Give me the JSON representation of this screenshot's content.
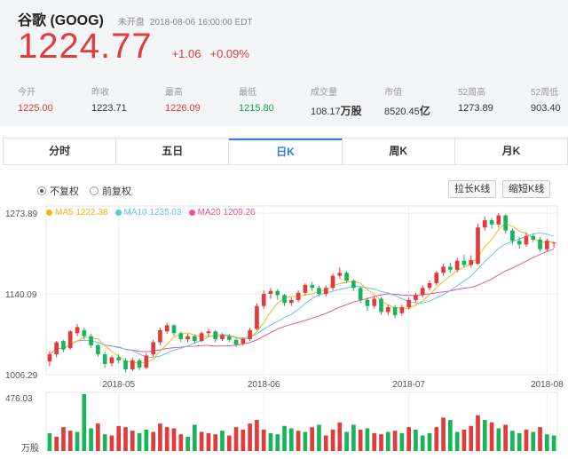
{
  "stock": {
    "name": "谷歌 (GOOG)",
    "status": "未开盘",
    "time": "2018-08-06  16:00:00  EDT",
    "price": "1224.77",
    "change": "+1.06",
    "change_pct": "+0.09%"
  },
  "stats": [
    {
      "label": "今开",
      "value": "1225.00",
      "color": "red"
    },
    {
      "label": "昨收",
      "value": "1223.71",
      "color": "normal"
    },
    {
      "label": "最高",
      "value": "1226.09",
      "color": "red"
    },
    {
      "label": "最低",
      "value": "1215.80",
      "color": "green"
    },
    {
      "label": "成交量",
      "value": "108.17",
      "unit": "万股",
      "color": "normal"
    },
    {
      "label": "市值",
      "value": "8520.45",
      "unit": "亿",
      "color": "normal"
    },
    {
      "label": "52周高",
      "value": "1273.89",
      "color": "normal"
    },
    {
      "label": "52周低",
      "value": "903.40",
      "color": "normal"
    }
  ],
  "tabs": [
    "分时",
    "五日",
    "日K",
    "周K",
    "月K"
  ],
  "active_tab": "日K",
  "radio": {
    "option1": "不复权",
    "option2": "前复权"
  },
  "buttons": {
    "stretch": "拉长K线",
    "shorten": "缩短K线"
  },
  "legend": {
    "ma5": "MA5 1222.38",
    "ma10": "MA10 1235.03",
    "ma20": "MA20 1209.26"
  },
  "colors": {
    "up": "#e23b3b",
    "down": "#19b35a",
    "ma5": "#f2b71b",
    "ma10": "#5ec9e8",
    "ma20": "#e9559a",
    "accent": "#2d7be5"
  },
  "chart_data": {
    "type": "candlestick",
    "price_axis_labels": [
      "1273.89",
      "1140.09",
      "1006.29"
    ],
    "ylim": [
      1006.29,
      1273.89
    ],
    "volume_axis_labels": [
      "476.03",
      "万股"
    ],
    "volume_max": 476.03,
    "x_labels": [
      "2018-05",
      "2018-06",
      "2018-07",
      "2018-08"
    ],
    "x_label_index": [
      10,
      31,
      52,
      72
    ],
    "candles": [
      [
        1028,
        1040,
        1020,
        1045
      ],
      [
        1040,
        1060,
        1035,
        1062
      ],
      [
        1062,
        1048,
        1044,
        1064
      ],
      [
        1050,
        1078,
        1048,
        1080
      ],
      [
        1075,
        1085,
        1070,
        1090
      ],
      [
        1080,
        1070,
        1065,
        1084
      ],
      [
        1070,
        1055,
        1050,
        1074
      ],
      [
        1055,
        1040,
        1036,
        1058
      ],
      [
        1040,
        1024,
        1018,
        1044
      ],
      [
        1025,
        1035,
        1020,
        1038
      ],
      [
        1035,
        1030,
        1025,
        1040
      ],
      [
        1030,
        1015,
        1010,
        1034
      ],
      [
        1015,
        1030,
        1012,
        1034
      ],
      [
        1030,
        1018,
        1014,
        1033
      ],
      [
        1018,
        1038,
        1015,
        1042
      ],
      [
        1040,
        1060,
        1036,
        1064
      ],
      [
        1060,
        1080,
        1055,
        1084
      ],
      [
        1078,
        1088,
        1074,
        1092
      ],
      [
        1088,
        1075,
        1070,
        1090
      ],
      [
        1075,
        1065,
        1060,
        1078
      ],
      [
        1065,
        1070,
        1060,
        1074
      ],
      [
        1070,
        1062,
        1058,
        1073
      ],
      [
        1062,
        1075,
        1060,
        1078
      ],
      [
        1075,
        1078,
        1070,
        1082
      ],
      [
        1078,
        1065,
        1060,
        1080
      ],
      [
        1065,
        1072,
        1062,
        1075
      ],
      [
        1070,
        1064,
        1060,
        1074
      ],
      [
        1064,
        1056,
        1052,
        1066
      ],
      [
        1058,
        1066,
        1054,
        1068
      ],
      [
        1065,
        1080,
        1062,
        1084
      ],
      [
        1082,
        1120,
        1080,
        1124
      ],
      [
        1120,
        1140,
        1115,
        1146
      ],
      [
        1140,
        1145,
        1132,
        1150
      ],
      [
        1145,
        1138,
        1130,
        1148
      ],
      [
        1138,
        1125,
        1120,
        1140
      ],
      [
        1125,
        1130,
        1120,
        1134
      ],
      [
        1130,
        1142,
        1126,
        1146
      ],
      [
        1142,
        1155,
        1138,
        1158
      ],
      [
        1155,
        1150,
        1145,
        1160
      ],
      [
        1150,
        1140,
        1136,
        1154
      ],
      [
        1140,
        1150,
        1136,
        1154
      ],
      [
        1150,
        1170,
        1146,
        1174
      ],
      [
        1170,
        1175,
        1165,
        1184
      ],
      [
        1175,
        1162,
        1158,
        1178
      ],
      [
        1162,
        1150,
        1145,
        1164
      ],
      [
        1150,
        1130,
        1125,
        1152
      ],
      [
        1130,
        1120,
        1112,
        1134
      ],
      [
        1120,
        1132,
        1116,
        1136
      ],
      [
        1132,
        1110,
        1105,
        1135
      ],
      [
        1110,
        1118,
        1105,
        1122
      ],
      [
        1118,
        1105,
        1100,
        1122
      ],
      [
        1108,
        1118,
        1104,
        1122
      ],
      [
        1118,
        1130,
        1114,
        1134
      ],
      [
        1130,
        1138,
        1126,
        1142
      ],
      [
        1138,
        1150,
        1134,
        1154
      ],
      [
        1150,
        1158,
        1146,
        1162
      ],
      [
        1158,
        1175,
        1154,
        1178
      ],
      [
        1175,
        1185,
        1170,
        1190
      ],
      [
        1185,
        1180,
        1175,
        1192
      ],
      [
        1180,
        1195,
        1176,
        1200
      ],
      [
        1195,
        1188,
        1184,
        1205
      ],
      [
        1188,
        1196,
        1184,
        1204
      ],
      [
        1190,
        1250,
        1188,
        1256
      ],
      [
        1250,
        1262,
        1245,
        1268
      ],
      [
        1262,
        1255,
        1248,
        1266
      ],
      [
        1255,
        1270,
        1250,
        1274
      ],
      [
        1270,
        1245,
        1240,
        1272
      ],
      [
        1245,
        1228,
        1222,
        1248
      ],
      [
        1228,
        1222,
        1215,
        1234
      ],
      [
        1222,
        1236,
        1218,
        1242
      ],
      [
        1236,
        1230,
        1226,
        1240
      ],
      [
        1230,
        1214,
        1210,
        1234
      ],
      [
        1214,
        1228,
        1210,
        1232
      ],
      [
        1225,
        1225,
        1216,
        1226
      ]
    ],
    "volumes": [
      [
        150,
        "down"
      ],
      [
        120,
        "up"
      ],
      [
        200,
        "up"
      ],
      [
        170,
        "up"
      ],
      [
        160,
        "down"
      ],
      [
        476,
        "down"
      ],
      [
        190,
        "down"
      ],
      [
        230,
        "up"
      ],
      [
        140,
        "down"
      ],
      [
        130,
        "up"
      ],
      [
        210,
        "up"
      ],
      [
        200,
        "up"
      ],
      [
        170,
        "up"
      ],
      [
        150,
        "down"
      ],
      [
        180,
        "down"
      ],
      [
        160,
        "up"
      ],
      [
        230,
        "up"
      ],
      [
        200,
        "up"
      ],
      [
        190,
        "up"
      ],
      [
        140,
        "up"
      ],
      [
        120,
        "down"
      ],
      [
        220,
        "down"
      ],
      [
        160,
        "up"
      ],
      [
        150,
        "up"
      ],
      [
        140,
        "up"
      ],
      [
        170,
        "down"
      ],
      [
        130,
        "up"
      ],
      [
        200,
        "up"
      ],
      [
        180,
        "up"
      ],
      [
        230,
        "up"
      ],
      [
        260,
        "up"
      ],
      [
        180,
        "up"
      ],
      [
        150,
        "down"
      ],
      [
        140,
        "down"
      ],
      [
        210,
        "down"
      ],
      [
        190,
        "down"
      ],
      [
        170,
        "up"
      ],
      [
        160,
        "down"
      ],
      [
        200,
        "up"
      ],
      [
        220,
        "down"
      ],
      [
        130,
        "up"
      ],
      [
        180,
        "up"
      ],
      [
        240,
        "up"
      ],
      [
        160,
        "down"
      ],
      [
        220,
        "down"
      ],
      [
        180,
        "up"
      ],
      [
        190,
        "down"
      ],
      [
        150,
        "up"
      ],
      [
        140,
        "up"
      ],
      [
        160,
        "down"
      ],
      [
        170,
        "up"
      ],
      [
        150,
        "down"
      ],
      [
        200,
        "up"
      ],
      [
        180,
        "down"
      ],
      [
        130,
        "down"
      ],
      [
        150,
        "down"
      ],
      [
        200,
        "up"
      ],
      [
        280,
        "up"
      ],
      [
        260,
        "down"
      ],
      [
        160,
        "down"
      ],
      [
        180,
        "up"
      ],
      [
        210,
        "up"
      ],
      [
        300,
        "up"
      ],
      [
        260,
        "down"
      ],
      [
        240,
        "up"
      ],
      [
        190,
        "down"
      ],
      [
        220,
        "up"
      ],
      [
        170,
        "down"
      ],
      [
        150,
        "down"
      ],
      [
        180,
        "up"
      ],
      [
        160,
        "down"
      ],
      [
        200,
        "up"
      ],
      [
        140,
        "down"
      ],
      [
        130,
        "down"
      ]
    ]
  }
}
